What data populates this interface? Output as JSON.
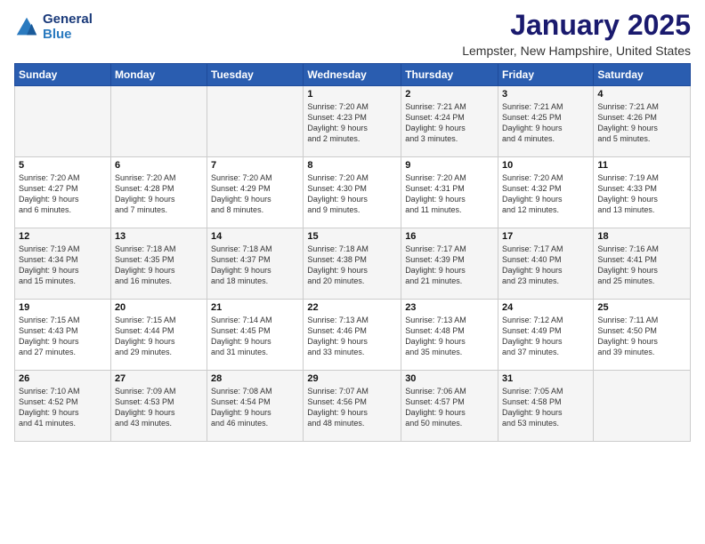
{
  "header": {
    "logo_line1": "General",
    "logo_line2": "Blue",
    "month": "January 2025",
    "location": "Lempster, New Hampshire, United States"
  },
  "days_of_week": [
    "Sunday",
    "Monday",
    "Tuesday",
    "Wednesday",
    "Thursday",
    "Friday",
    "Saturday"
  ],
  "weeks": [
    [
      {
        "day": "",
        "content": ""
      },
      {
        "day": "",
        "content": ""
      },
      {
        "day": "",
        "content": ""
      },
      {
        "day": "1",
        "content": "Sunrise: 7:20 AM\nSunset: 4:23 PM\nDaylight: 9 hours\nand 2 minutes."
      },
      {
        "day": "2",
        "content": "Sunrise: 7:21 AM\nSunset: 4:24 PM\nDaylight: 9 hours\nand 3 minutes."
      },
      {
        "day": "3",
        "content": "Sunrise: 7:21 AM\nSunset: 4:25 PM\nDaylight: 9 hours\nand 4 minutes."
      },
      {
        "day": "4",
        "content": "Sunrise: 7:21 AM\nSunset: 4:26 PM\nDaylight: 9 hours\nand 5 minutes."
      }
    ],
    [
      {
        "day": "5",
        "content": "Sunrise: 7:20 AM\nSunset: 4:27 PM\nDaylight: 9 hours\nand 6 minutes."
      },
      {
        "day": "6",
        "content": "Sunrise: 7:20 AM\nSunset: 4:28 PM\nDaylight: 9 hours\nand 7 minutes."
      },
      {
        "day": "7",
        "content": "Sunrise: 7:20 AM\nSunset: 4:29 PM\nDaylight: 9 hours\nand 8 minutes."
      },
      {
        "day": "8",
        "content": "Sunrise: 7:20 AM\nSunset: 4:30 PM\nDaylight: 9 hours\nand 9 minutes."
      },
      {
        "day": "9",
        "content": "Sunrise: 7:20 AM\nSunset: 4:31 PM\nDaylight: 9 hours\nand 11 minutes."
      },
      {
        "day": "10",
        "content": "Sunrise: 7:20 AM\nSunset: 4:32 PM\nDaylight: 9 hours\nand 12 minutes."
      },
      {
        "day": "11",
        "content": "Sunrise: 7:19 AM\nSunset: 4:33 PM\nDaylight: 9 hours\nand 13 minutes."
      }
    ],
    [
      {
        "day": "12",
        "content": "Sunrise: 7:19 AM\nSunset: 4:34 PM\nDaylight: 9 hours\nand 15 minutes."
      },
      {
        "day": "13",
        "content": "Sunrise: 7:18 AM\nSunset: 4:35 PM\nDaylight: 9 hours\nand 16 minutes."
      },
      {
        "day": "14",
        "content": "Sunrise: 7:18 AM\nSunset: 4:37 PM\nDaylight: 9 hours\nand 18 minutes."
      },
      {
        "day": "15",
        "content": "Sunrise: 7:18 AM\nSunset: 4:38 PM\nDaylight: 9 hours\nand 20 minutes."
      },
      {
        "day": "16",
        "content": "Sunrise: 7:17 AM\nSunset: 4:39 PM\nDaylight: 9 hours\nand 21 minutes."
      },
      {
        "day": "17",
        "content": "Sunrise: 7:17 AM\nSunset: 4:40 PM\nDaylight: 9 hours\nand 23 minutes."
      },
      {
        "day": "18",
        "content": "Sunrise: 7:16 AM\nSunset: 4:41 PM\nDaylight: 9 hours\nand 25 minutes."
      }
    ],
    [
      {
        "day": "19",
        "content": "Sunrise: 7:15 AM\nSunset: 4:43 PM\nDaylight: 9 hours\nand 27 minutes."
      },
      {
        "day": "20",
        "content": "Sunrise: 7:15 AM\nSunset: 4:44 PM\nDaylight: 9 hours\nand 29 minutes."
      },
      {
        "day": "21",
        "content": "Sunrise: 7:14 AM\nSunset: 4:45 PM\nDaylight: 9 hours\nand 31 minutes."
      },
      {
        "day": "22",
        "content": "Sunrise: 7:13 AM\nSunset: 4:46 PM\nDaylight: 9 hours\nand 33 minutes."
      },
      {
        "day": "23",
        "content": "Sunrise: 7:13 AM\nSunset: 4:48 PM\nDaylight: 9 hours\nand 35 minutes."
      },
      {
        "day": "24",
        "content": "Sunrise: 7:12 AM\nSunset: 4:49 PM\nDaylight: 9 hours\nand 37 minutes."
      },
      {
        "day": "25",
        "content": "Sunrise: 7:11 AM\nSunset: 4:50 PM\nDaylight: 9 hours\nand 39 minutes."
      }
    ],
    [
      {
        "day": "26",
        "content": "Sunrise: 7:10 AM\nSunset: 4:52 PM\nDaylight: 9 hours\nand 41 minutes."
      },
      {
        "day": "27",
        "content": "Sunrise: 7:09 AM\nSunset: 4:53 PM\nDaylight: 9 hours\nand 43 minutes."
      },
      {
        "day": "28",
        "content": "Sunrise: 7:08 AM\nSunset: 4:54 PM\nDaylight: 9 hours\nand 46 minutes."
      },
      {
        "day": "29",
        "content": "Sunrise: 7:07 AM\nSunset: 4:56 PM\nDaylight: 9 hours\nand 48 minutes."
      },
      {
        "day": "30",
        "content": "Sunrise: 7:06 AM\nSunset: 4:57 PM\nDaylight: 9 hours\nand 50 minutes."
      },
      {
        "day": "31",
        "content": "Sunrise: 7:05 AM\nSunset: 4:58 PM\nDaylight: 9 hours\nand 53 minutes."
      },
      {
        "day": "",
        "content": ""
      }
    ]
  ]
}
